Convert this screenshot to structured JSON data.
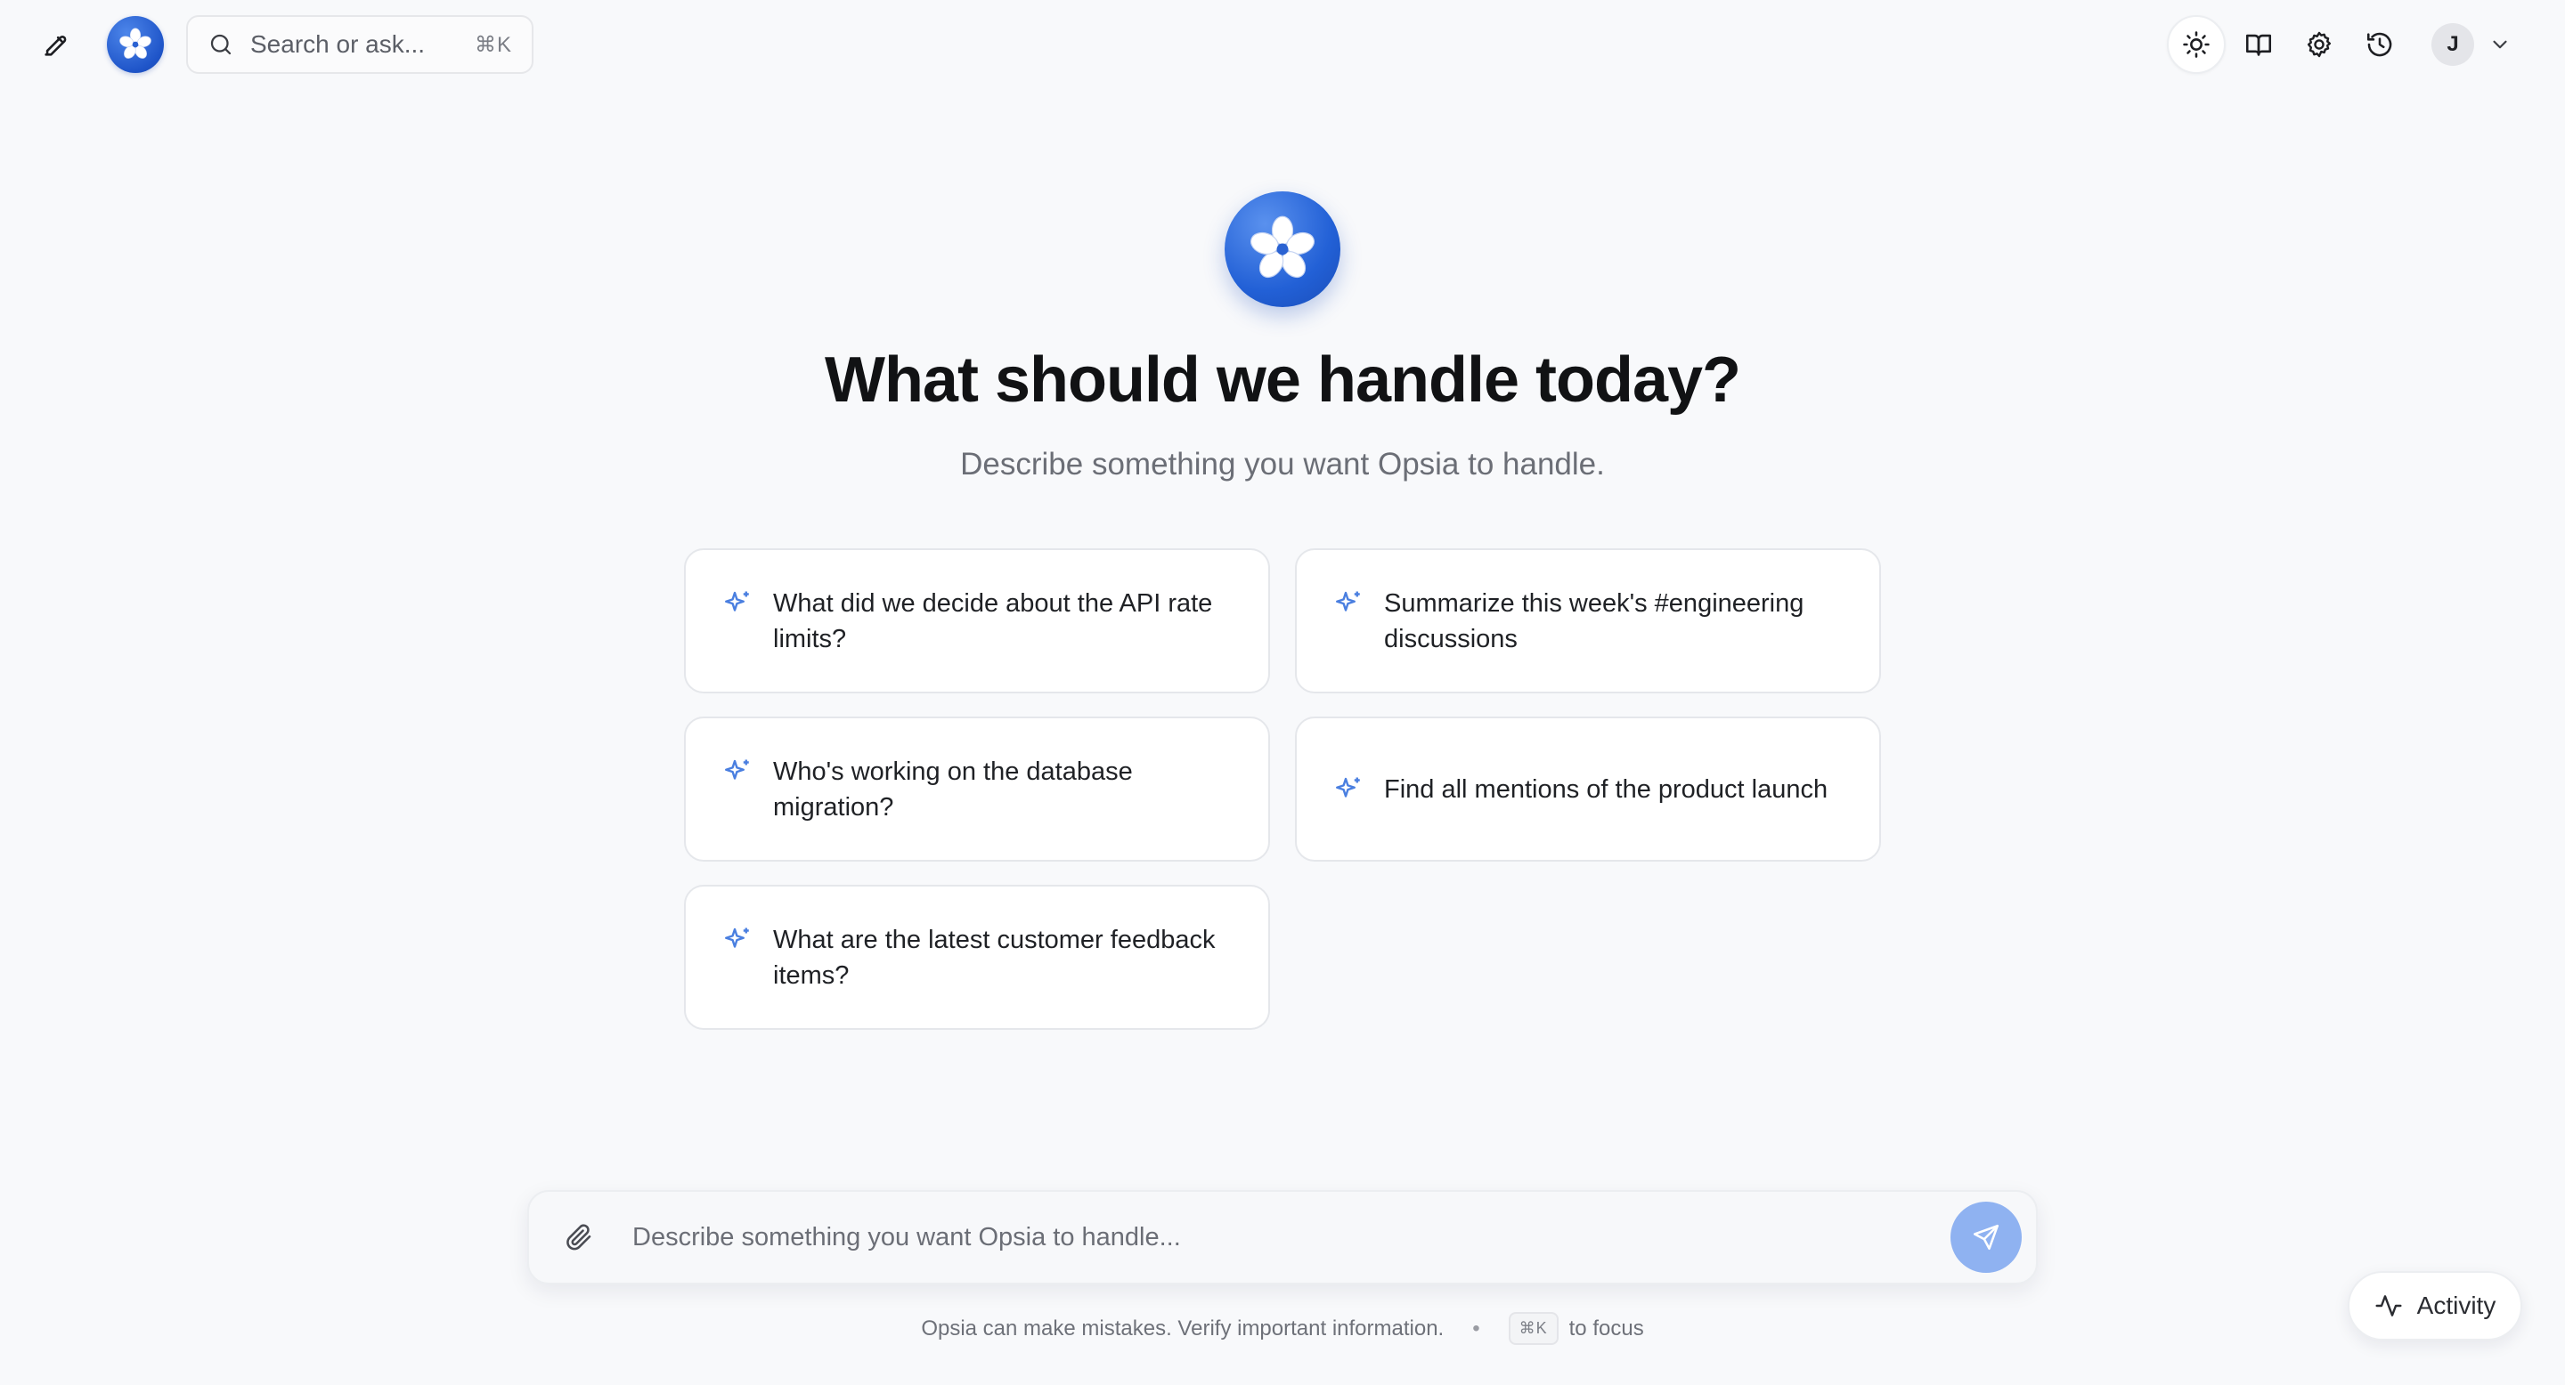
{
  "header": {
    "search_placeholder": "Search or ask...",
    "search_shortcut": "⌘K",
    "user_initial": "J"
  },
  "hero": {
    "title": "What should we handle today?",
    "subtitle": "Describe something you want Opsia to handle."
  },
  "suggestions": [
    "What did we decide about the API rate limits?",
    "Summarize this week's #engineering discussions",
    "Who's working on the database migration?",
    "Find all mentions of the product launch",
    "What are the latest customer feedback items?"
  ],
  "composer": {
    "placeholder": "Describe something you want Opsia to handle..."
  },
  "footer": {
    "disclaimer": "Opsia can make mistakes. Verify important information.",
    "separator": "•",
    "shortcut": "⌘K",
    "shortcut_hint": "to focus"
  },
  "activity": {
    "label": "Activity"
  },
  "colors": {
    "brand_blue": "#2260d6",
    "accent_sparkle": "#4a7fe0",
    "send_button": "#8fb2f1",
    "background": "#f8f9fb"
  },
  "icons": [
    "edit-icon",
    "logo-icon",
    "search-icon",
    "sun-icon",
    "book-icon",
    "gear-icon",
    "history-icon",
    "chevron-down-icon",
    "sparkle-icon",
    "paperclip-icon",
    "send-icon",
    "activity-icon"
  ]
}
